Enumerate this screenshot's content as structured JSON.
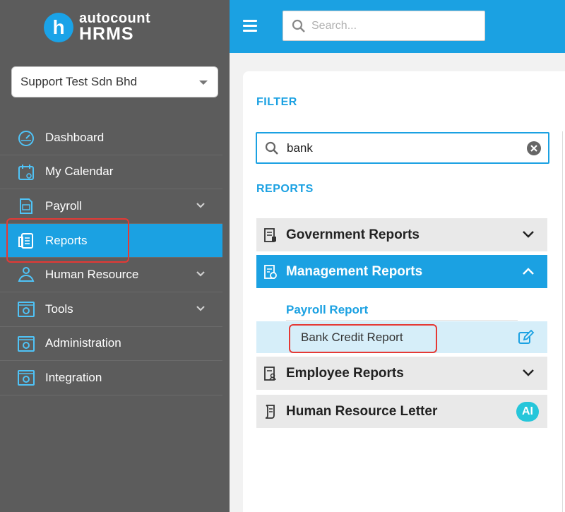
{
  "brand": {
    "line1": "autocount",
    "line2": "HRMS",
    "mark": "h"
  },
  "company_select": {
    "value": "Support Test Sdn Bhd"
  },
  "nav": {
    "items": [
      {
        "label": "Dashboard",
        "icon": "dashboard-icon"
      },
      {
        "label": "My Calendar",
        "icon": "calendar-icon"
      },
      {
        "label": "Payroll",
        "icon": "payroll-icon"
      },
      {
        "label": "Reports",
        "icon": "reports-icon"
      },
      {
        "label": "Human Resource",
        "icon": "human-resource-icon"
      },
      {
        "label": "Tools",
        "icon": "tools-icon"
      },
      {
        "label": "Administration",
        "icon": "administration-icon"
      },
      {
        "label": "Integration",
        "icon": "integration-icon"
      }
    ],
    "active": "Reports"
  },
  "search": {
    "placeholder": "Search..."
  },
  "filter": {
    "title": "FILTER",
    "value": "bank"
  },
  "reports": {
    "title": "REPORTS",
    "groups": [
      {
        "label": "Government Reports",
        "expanded": false
      },
      {
        "label": "Management Reports",
        "expanded": true
      },
      {
        "label": "Employee Reports",
        "expanded": false
      },
      {
        "label": "Human Resource Letter",
        "badge": "AI"
      }
    ],
    "sub_section": "Payroll Report",
    "result": "Bank Credit Report"
  },
  "colors": {
    "accent": "#1ba1e2",
    "sidebar": "#5c5c5c",
    "highlight": "#e53935",
    "ai_badge": "#26c6da"
  }
}
